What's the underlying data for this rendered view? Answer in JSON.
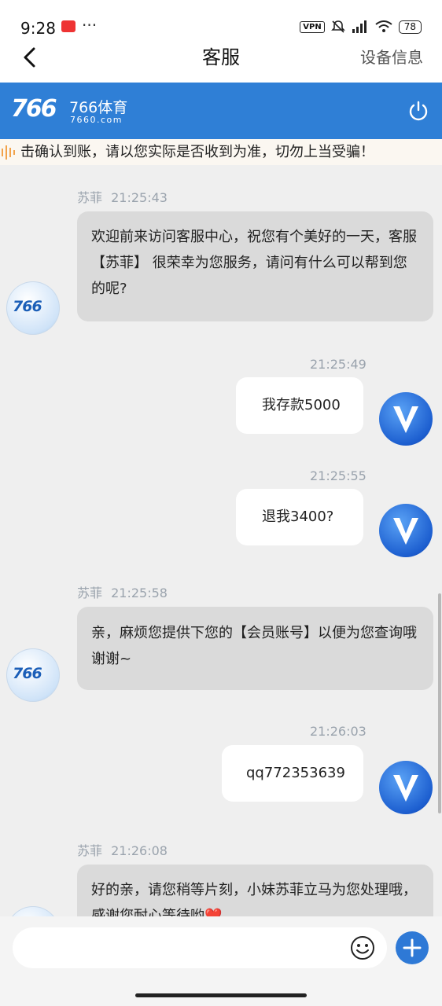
{
  "status_bar": {
    "time": "9:28",
    "more": "···",
    "vpn": "VPN",
    "battery": "78"
  },
  "nav": {
    "title": "客服",
    "right_action": "设备信息"
  },
  "brand": {
    "logo_text": "766",
    "name": "766体育",
    "domain": "7660.com"
  },
  "notice": {
    "text": "击确认到账，请以您实际是否收到为准，切勿上当受骗！"
  },
  "messages": [
    {
      "sender": "苏菲",
      "time": "21:25:43",
      "text": "欢迎前来访问客服中心，祝您有个美好的一天，客服【苏菲】 很荣幸为您服务，请问有什么可以帮到您的呢?"
    },
    {
      "time": "21:25:49",
      "text": "我存款5000"
    },
    {
      "time": "21:25:55",
      "text": "退我3400?"
    },
    {
      "sender": "苏菲",
      "time": "21:25:58",
      "text": "亲，麻烦您提供下您的【会员账号】以便为您查询哦 谢谢~"
    },
    {
      "time": "21:26:03",
      "text": "qq772353639"
    },
    {
      "sender": "苏菲",
      "time": "21:26:08",
      "text": "好的亲，请您稍等片刻，小妹苏菲立马为您处理哦，感谢您耐心等待哟❤️"
    }
  ],
  "input": {
    "value": "",
    "placeholder": ""
  },
  "colors": {
    "brand_blue": "#2f7fd6",
    "page_bg": "#efefef",
    "agent_bubble": "#dadada",
    "user_bubble": "#ffffff"
  }
}
